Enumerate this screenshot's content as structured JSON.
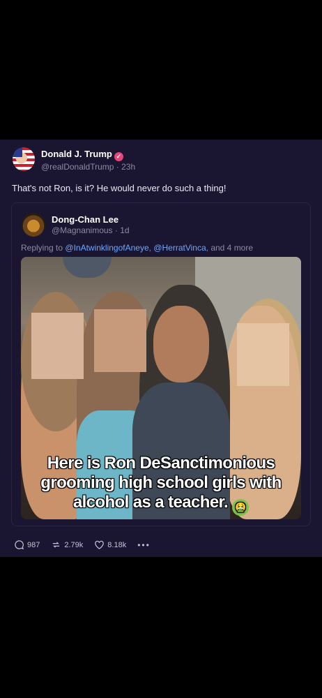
{
  "post": {
    "author_name": "Donald J. Trump",
    "author_handle": "@realDonaldTrump",
    "time": "23h",
    "text": "That's not Ron, is it? He would never do such a thing!",
    "quote": {
      "author_name": "Dong-Chan Lee",
      "author_handle": "@Magnanimous",
      "time": "1d",
      "reply_prefix": "Replying to",
      "reply_user1": "@InAtwinklingofAneye",
      "reply_sep": ",",
      "reply_user2": "@HerratVinca",
      "reply_suffix": ", and 4 more",
      "media_caption_line1": "Here is Ron DeSanctimonious",
      "media_caption_line2": "grooming high school girls with",
      "media_caption_line3": "alcohol as a teacher."
    },
    "actions": {
      "replies": "987",
      "retruths": "2.79k",
      "likes": "8.18k",
      "more": "•••"
    }
  },
  "colors": {
    "background": "#000000",
    "card": "#1a1530",
    "link": "#6fa8ff",
    "verified": "#e5467a"
  }
}
